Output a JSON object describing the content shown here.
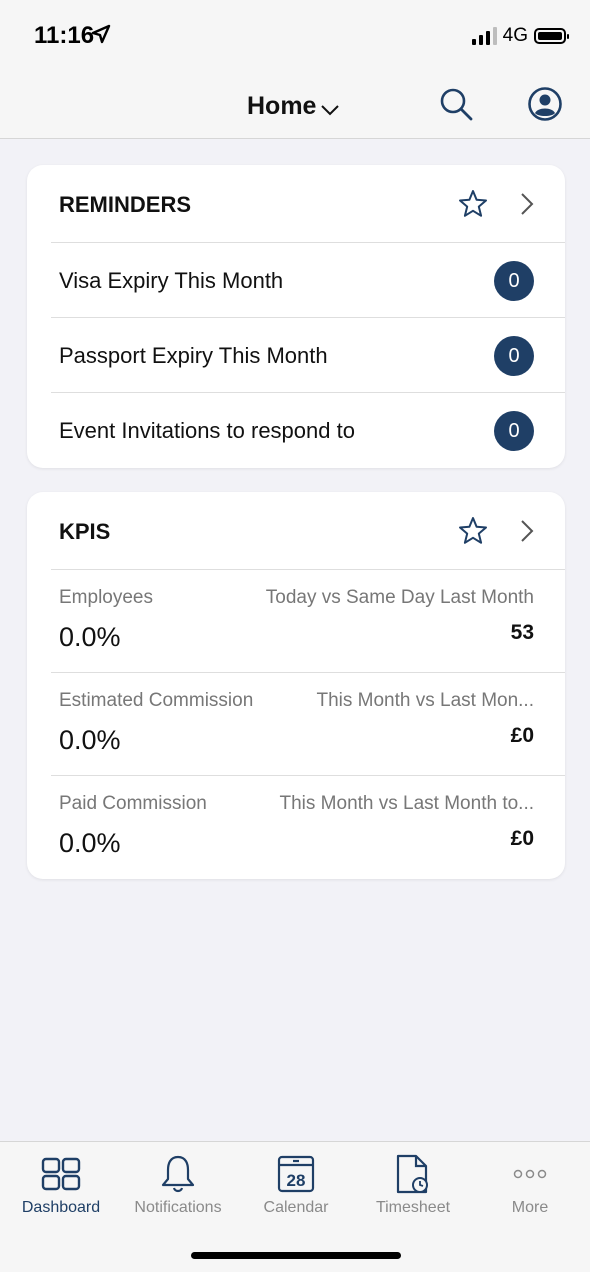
{
  "status_bar": {
    "time": "11:16",
    "network": "4G"
  },
  "nav": {
    "title": "Home",
    "icons": [
      "search-icon",
      "profile-icon",
      "chevron-down-icon"
    ]
  },
  "reminders": {
    "title": "REMINDERS",
    "items": [
      {
        "label": "Visa Expiry This Month",
        "count": "0"
      },
      {
        "label": "Passport Expiry This Month",
        "count": "0"
      },
      {
        "label": "Event Invitations to respond to",
        "count": "0"
      }
    ]
  },
  "kpis": {
    "title": "KPIS",
    "items": [
      {
        "name": "Employees",
        "period": "Today vs Same Day Last Month",
        "percent": "0.0%",
        "value": "53"
      },
      {
        "name": "Estimated Commission",
        "period": "This Month vs Last Mon...",
        "percent": "0.0%",
        "value": "£0"
      },
      {
        "name": "Paid Commission",
        "period": "This Month vs Last Month to...",
        "percent": "0.0%",
        "value": "£0"
      }
    ]
  },
  "tab_bar": {
    "active": "Dashboard",
    "tabs": [
      {
        "label": "Dashboard",
        "icon": "dashboard-icon"
      },
      {
        "label": "Notifications",
        "icon": "bell-icon"
      },
      {
        "label": "Calendar",
        "icon": "calendar-icon",
        "date": "28"
      },
      {
        "label": "Timesheet",
        "icon": "timesheet-icon"
      },
      {
        "label": "More",
        "icon": "more-icon"
      }
    ]
  },
  "colors": {
    "accent": "#1f3f66",
    "background": "#f2f2f7",
    "card": "#ffffff",
    "muted_text": "#777777"
  }
}
